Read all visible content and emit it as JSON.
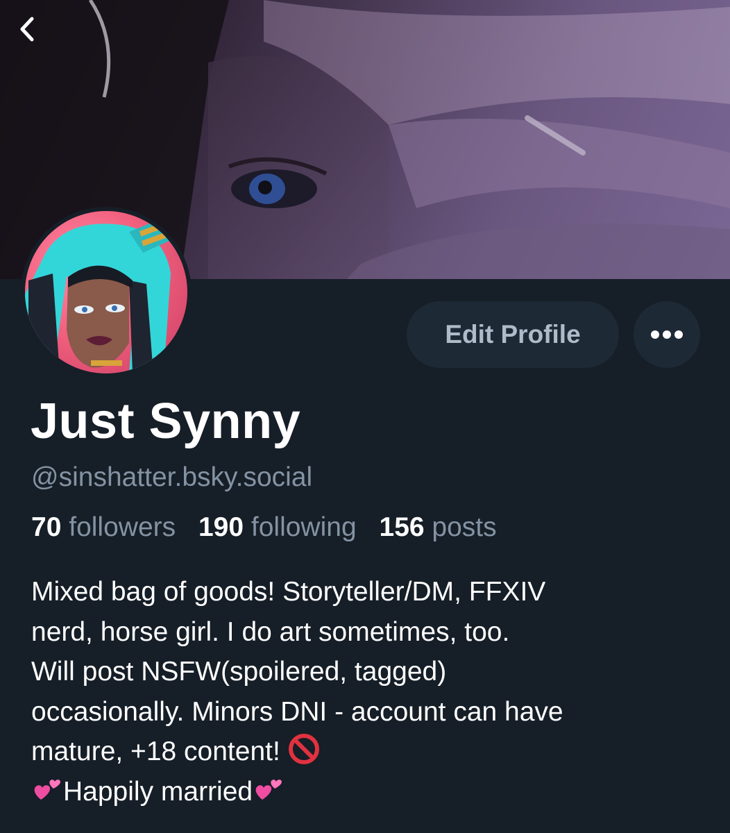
{
  "nav": {
    "back_icon": "chevron-left-icon"
  },
  "banner": {
    "image": "dark purple-toned illustration of a face with eye and hand"
  },
  "avatar": {
    "image": "illustrated portrait, teal hair, pink background"
  },
  "actions": {
    "edit_label": "Edit Profile",
    "more_icon": "more-horizontal-icon"
  },
  "profile": {
    "display_name": "Just Synny",
    "handle": "@sinshatter.bsky.social"
  },
  "stats": {
    "followers_count": "70",
    "followers_label": "followers",
    "following_count": "190",
    "following_label": "following",
    "posts_count": "156",
    "posts_label": "posts"
  },
  "bio": {
    "lines": [
      "Mixed bag of goods! Storyteller/DM, FFXIV",
      "nerd, horse girl. I do art sometimes, too.",
      "Will post NSFW(spoilered, tagged)",
      "occasionally. Minors DNI - account can have",
      "mature, +18 content!",
      "Happily married"
    ],
    "emoji": {
      "prohibited": "prohibited-icon",
      "hearts": "two-hearts-icon"
    }
  },
  "colors": {
    "background": "#161e27",
    "button_bg": "#1e2936",
    "muted_text": "#8493a3",
    "button_text": "#aebbc9"
  }
}
